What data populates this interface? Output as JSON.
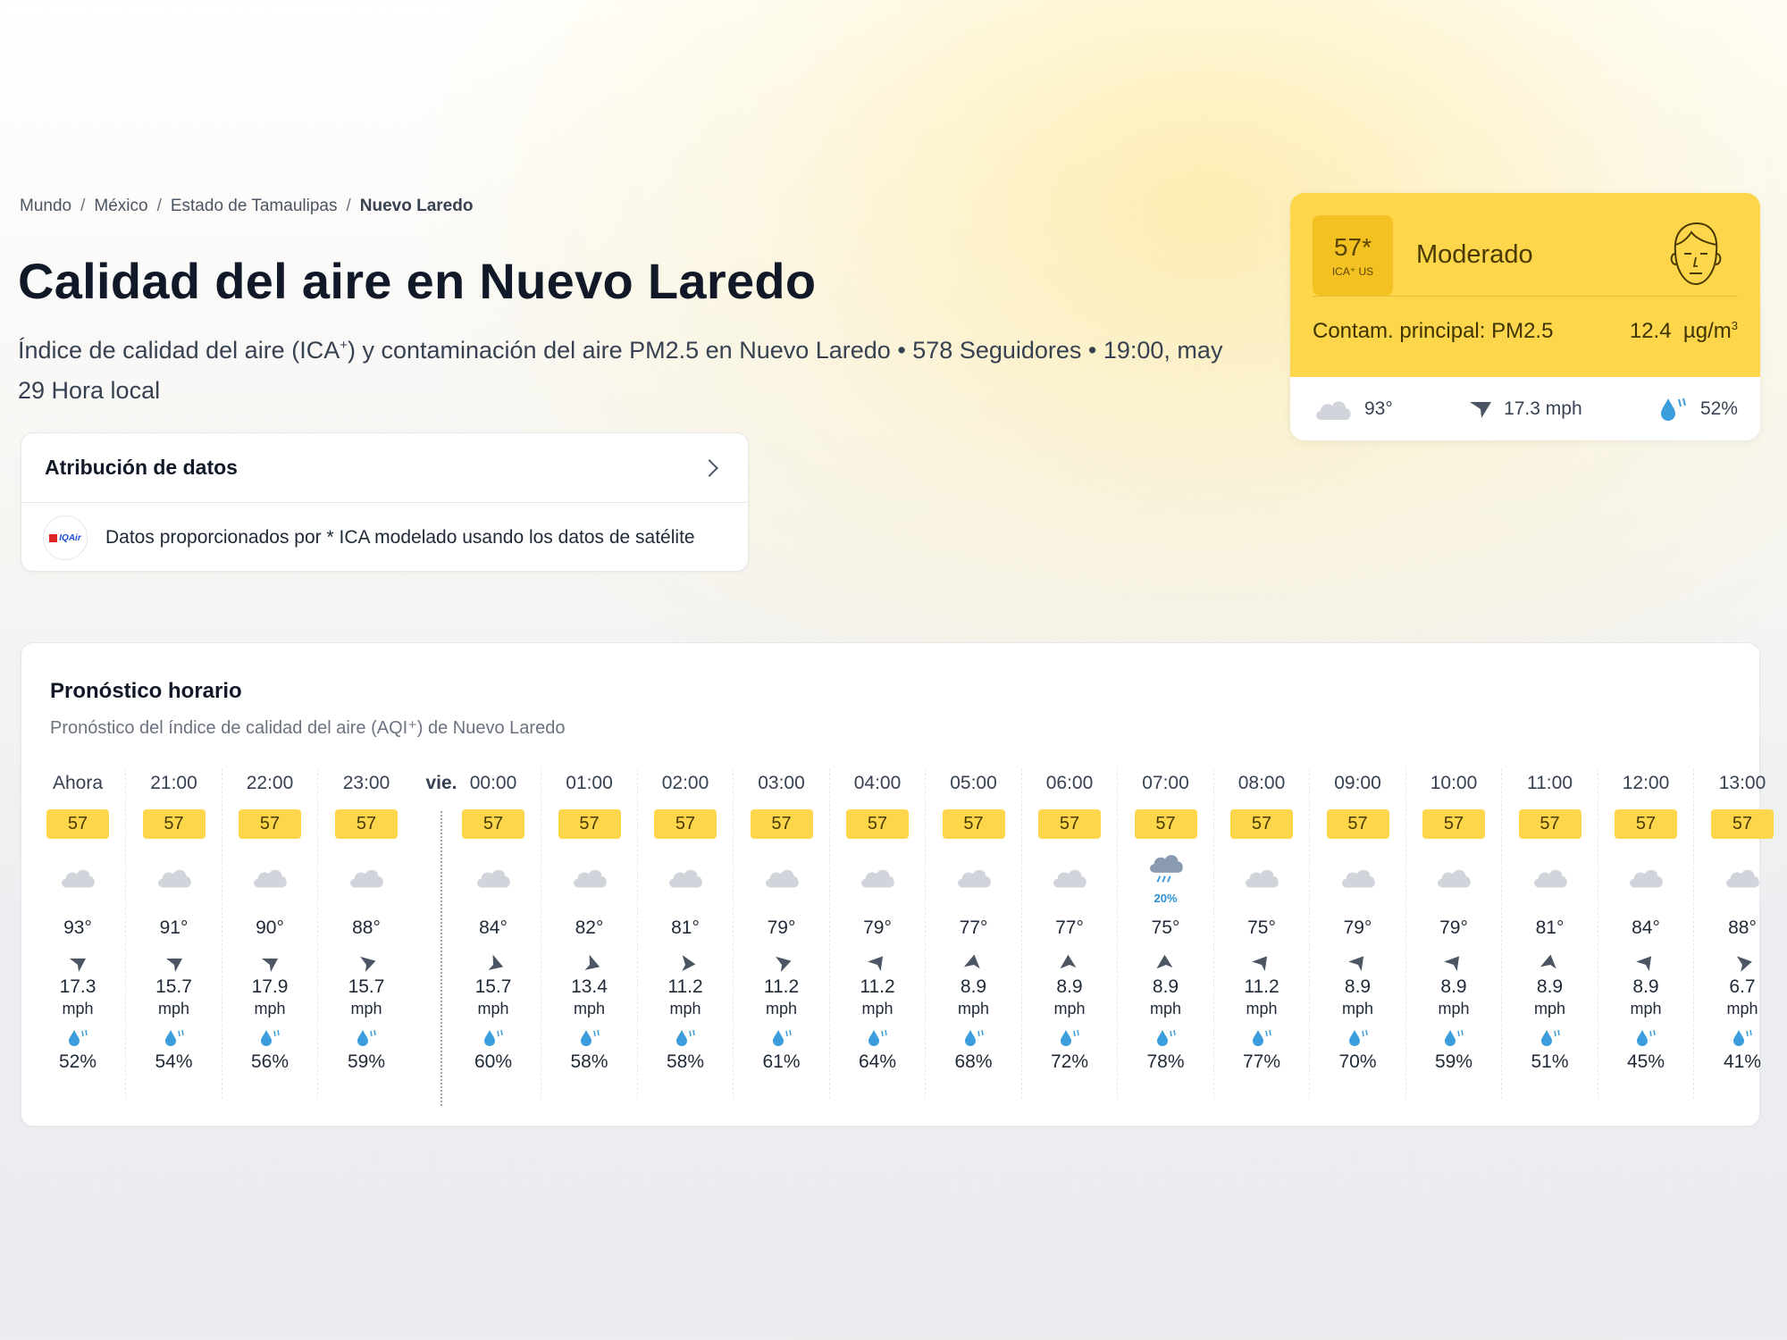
{
  "breadcrumb": {
    "items": [
      "Mundo",
      "México",
      "Estado de Tamaulipas"
    ],
    "current": "Nuevo Laredo",
    "separator": "/"
  },
  "title": "Calidad del aire en Nuevo Laredo",
  "subtitle_pre": "Índice de calidad del aire (ICA",
  "subtitle_sup": "+",
  "subtitle_post": ") y contaminación del aire PM2.5 en Nuevo Laredo • 578 Seguidores • 19:00, may 29 Hora local",
  "attribution": {
    "title": "Atribución de datos",
    "logo_text": "IQAir",
    "text": "Datos proporcionados por * ICA modelado usando los datos de satélite"
  },
  "aqi_card": {
    "value": "57*",
    "unit": "ICA⁺ US",
    "level": "Moderado",
    "pollutant_label": "Contam. principal: PM2.5",
    "concentration": "12.4",
    "concentration_unit": "µg/m",
    "concentration_unit_sup": "3",
    "temperature": "93°",
    "wind": "17.3 mph",
    "humidity": "52%",
    "color": "#fdd64b"
  },
  "forecast": {
    "title": "Pronóstico horario",
    "subtitle": "Pronóstico del índice de calidad del aire (AQI⁺) de Nuevo Laredo",
    "day_label": "vie.",
    "wind_unit": "mph",
    "hours": [
      {
        "time": "Ahora",
        "aqi": "57",
        "icon": "cloud-icon",
        "temp": "93°",
        "wind": "17.3",
        "wind_dir": 200,
        "humidity": "52%"
      },
      {
        "time": "21:00",
        "aqi": "57",
        "icon": "cloud-icon",
        "temp": "91°",
        "wind": "15.7",
        "wind_dir": 200,
        "humidity": "54%"
      },
      {
        "time": "22:00",
        "aqi": "57",
        "icon": "cloud-icon",
        "temp": "90°",
        "wind": "17.9",
        "wind_dir": 200,
        "humidity": "56%"
      },
      {
        "time": "23:00",
        "aqi": "57",
        "icon": "cloud-icon",
        "temp": "88°",
        "wind": "15.7",
        "wind_dir": 215,
        "humidity": "59%"
      },
      {
        "time": "00:00",
        "aqi": "57",
        "icon": "cloud-icon",
        "temp": "84°",
        "wind": "15.7",
        "wind_dir": 250,
        "humidity": "60%"
      },
      {
        "time": "01:00",
        "aqi": "57",
        "icon": "cloud-icon",
        "temp": "82°",
        "wind": "13.4",
        "wind_dir": 250,
        "humidity": "58%"
      },
      {
        "time": "02:00",
        "aqi": "57",
        "icon": "cloud-icon",
        "temp": "81°",
        "wind": "11.2",
        "wind_dir": 235,
        "humidity": "58%"
      },
      {
        "time": "03:00",
        "aqi": "57",
        "icon": "cloud-icon",
        "temp": "79°",
        "wind": "11.2",
        "wind_dir": 215,
        "humidity": "61%"
      },
      {
        "time": "04:00",
        "aqi": "57",
        "icon": "cloud-icon",
        "temp": "79°",
        "wind": "11.2",
        "wind_dir": 180,
        "humidity": "64%"
      },
      {
        "time": "05:00",
        "aqi": "57",
        "icon": "cloud-icon",
        "temp": "77°",
        "wind": "8.9",
        "wind_dir": 150,
        "humidity": "68%"
      },
      {
        "time": "06:00",
        "aqi": "57",
        "icon": "cloud-icon",
        "temp": "77°",
        "wind": "8.9",
        "wind_dir": 140,
        "humidity": "72%"
      },
      {
        "time": "07:00",
        "aqi": "57",
        "icon": "rain-cloud-icon",
        "rain": "20%",
        "temp": "75°",
        "wind": "8.9",
        "wind_dir": 140,
        "humidity": "78%"
      },
      {
        "time": "08:00",
        "aqi": "57",
        "icon": "cloud-icon",
        "temp": "75°",
        "wind": "11.2",
        "wind_dir": 180,
        "humidity": "77%"
      },
      {
        "time": "09:00",
        "aqi": "57",
        "icon": "cloud-icon",
        "temp": "79°",
        "wind": "8.9",
        "wind_dir": 180,
        "humidity": "70%"
      },
      {
        "time": "10:00",
        "aqi": "57",
        "icon": "cloud-icon",
        "temp": "79°",
        "wind": "8.9",
        "wind_dir": 180,
        "humidity": "59%"
      },
      {
        "time": "11:00",
        "aqi": "57",
        "icon": "cloud-icon",
        "temp": "81°",
        "wind": "8.9",
        "wind_dir": 150,
        "humidity": "51%"
      },
      {
        "time": "12:00",
        "aqi": "57",
        "icon": "cloud-icon",
        "temp": "84°",
        "wind": "8.9",
        "wind_dir": 180,
        "humidity": "45%"
      },
      {
        "time": "13:00",
        "aqi": "57",
        "icon": "cloud-icon",
        "temp": "88°",
        "wind": "6.7",
        "wind_dir": 220,
        "humidity": "41%"
      }
    ]
  }
}
